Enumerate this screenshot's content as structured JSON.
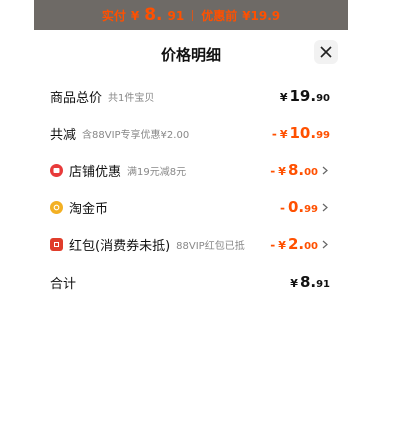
{
  "topbar": {
    "pay_label": "实付",
    "pay_currency": "¥",
    "pay_int": "8.",
    "pay_dec": "91",
    "orig_label": "优惠前",
    "orig_price": "¥19.9"
  },
  "sheet": {
    "title": "价格明细",
    "close_icon": "close-icon"
  },
  "rows": [
    {
      "label": "商品总价",
      "sub": "共1件宝贝",
      "sign": "",
      "currency": "¥",
      "int": "19.",
      "dec": "90",
      "color": "black",
      "chevron": false
    },
    {
      "label": "共减",
      "sub": "含88VIP专享优惠¥2.00",
      "sign": "-",
      "currency": "¥",
      "int": "10.",
      "dec": "99",
      "color": "orange",
      "chevron": false
    },
    {
      "label": "店铺优惠",
      "sub": "满19元减8元",
      "sign": "-",
      "currency": "¥",
      "int": "8.",
      "dec": "00",
      "color": "orange",
      "chevron": true,
      "icon": "store-icon"
    },
    {
      "label": "淘金币",
      "sub": "",
      "sign": "-",
      "currency": "",
      "int": "0.",
      "dec": "99",
      "color": "orange",
      "chevron": true,
      "icon": "coin-icon"
    },
    {
      "label": "红包(消费券未抵)",
      "sub": "88VIP红包已抵",
      "sign": "-",
      "currency": "¥",
      "int": "2.",
      "dec": "00",
      "color": "orange",
      "chevron": true,
      "icon": "red-packet-icon"
    },
    {
      "label": "合计",
      "sub": "",
      "sign": "",
      "currency": "¥",
      "int": "8.",
      "dec": "91",
      "color": "black",
      "chevron": false
    }
  ],
  "colors": {
    "accent": "#ff5000",
    "overlay": "#6e6a66"
  }
}
